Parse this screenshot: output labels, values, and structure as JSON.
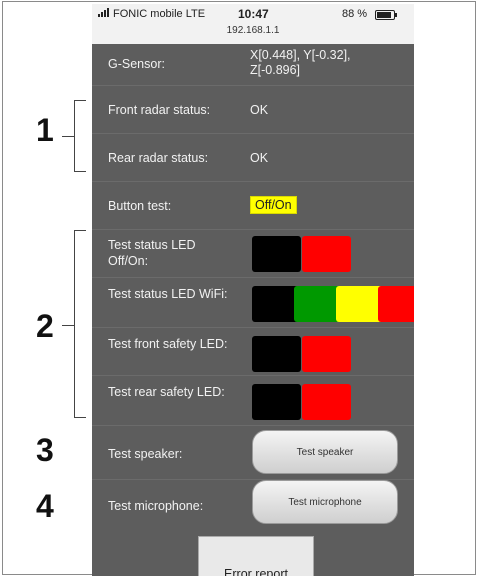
{
  "status_bar": {
    "carrier": "FONIC mobile  LTE",
    "time": "10:47",
    "battery": "88 %",
    "ip": "192.168.1.1"
  },
  "rows": {
    "gsensor": {
      "label": "G-Sensor:",
      "value": "X[0.448], Y[-0.32], Z[-0.896]"
    },
    "front_radar": {
      "label": "Front radar status:",
      "value": "OK"
    },
    "rear_radar": {
      "label": "Rear radar status:",
      "value": "OK"
    },
    "button_test": {
      "label": "Button test:",
      "value": "Off/On"
    },
    "status_led_onoff": {
      "label": "Test status LED Off/On:",
      "colors": [
        "#000000",
        "#ff0000"
      ]
    },
    "status_led_wifi": {
      "label": "Test status LED WiFi:",
      "colors": [
        "#000000",
        "#009900",
        "#ffff00",
        "#ff0000"
      ]
    },
    "front_safety_led": {
      "label": "Test front safety LED:",
      "colors": [
        "#000000",
        "#ff0000"
      ]
    },
    "rear_safety_led": {
      "label": "Test rear safety LED:",
      "colors": [
        "#000000",
        "#ff0000"
      ]
    },
    "speaker": {
      "label": "Test speaker:",
      "button": "Test speaker"
    },
    "microphone": {
      "label": "Test microphone:",
      "button": "Test microphone"
    }
  },
  "error_report": "Error report",
  "markers": [
    "1",
    "2",
    "3",
    "4"
  ]
}
